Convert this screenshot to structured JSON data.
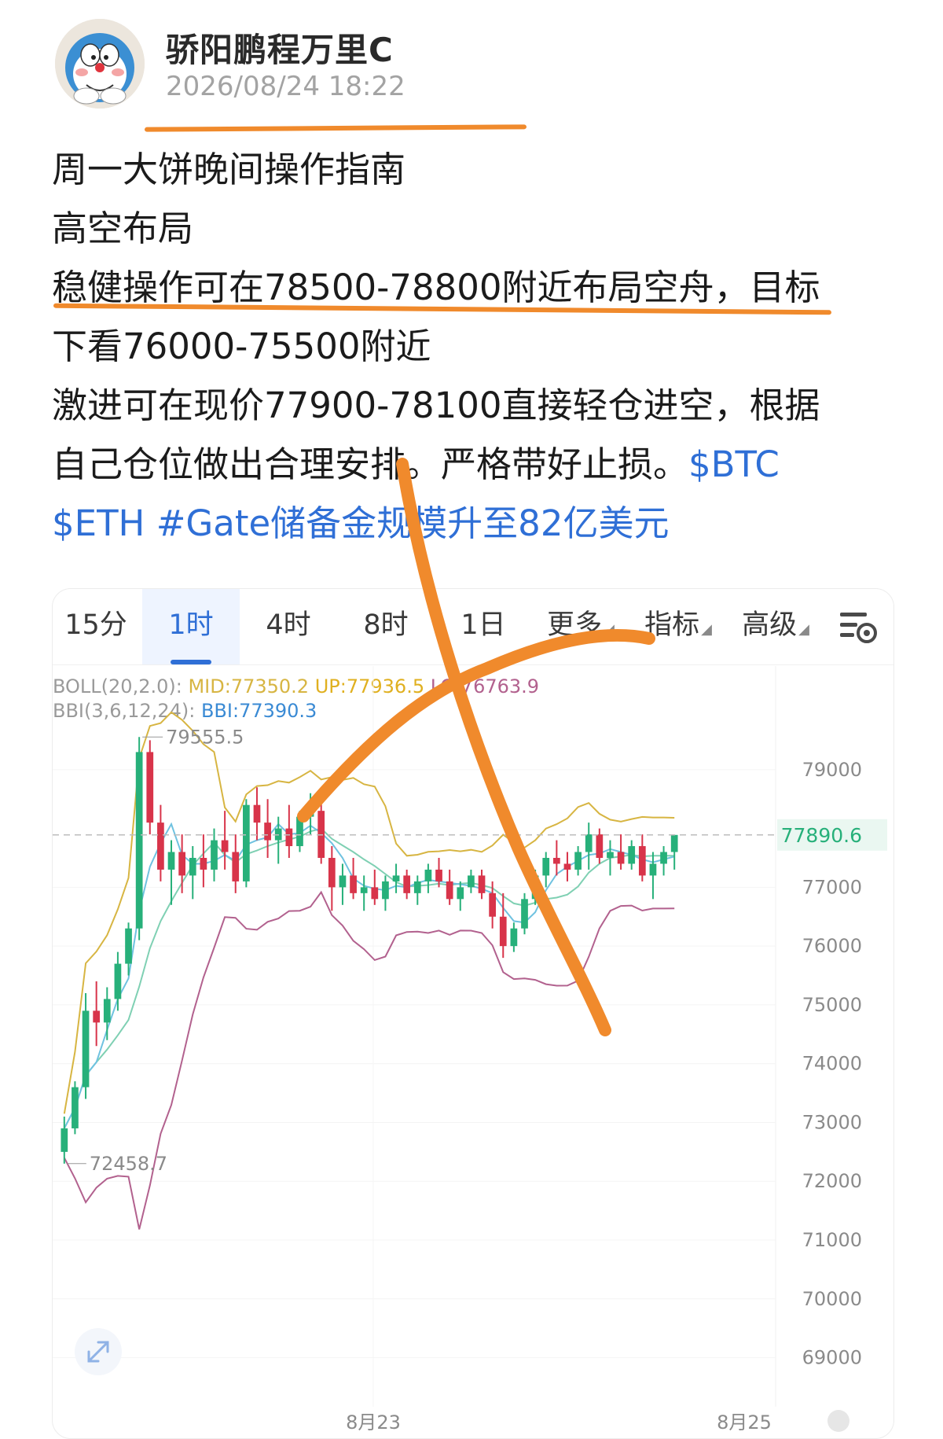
{
  "author": {
    "name": "骄阳鹏程万里C",
    "time": "2026/08/24 18:22"
  },
  "post": {
    "lines": [
      "周一大饼晚间操作指南",
      "高空布局",
      "稳健操作可在78500-78800附近布局空舟，目标",
      "下看76000-75500附近",
      "激进可在现价77900-78100直接轻仓进空，根据",
      "自己仓位做出合理安排。严格带好止损。"
    ],
    "tags": [
      "$BTC",
      "$ETH",
      "#Gate储备金规模升至82亿美元"
    ]
  },
  "chart": {
    "tabs": [
      {
        "label": "15分"
      },
      {
        "label": "1时",
        "active": true
      },
      {
        "label": "4时"
      },
      {
        "label": "8时"
      },
      {
        "label": "1日"
      },
      {
        "label": "更多",
        "caret": true
      },
      {
        "label": "指标",
        "caret": true
      },
      {
        "label": "高级",
        "caret": true
      }
    ],
    "indicators": {
      "boll_label": "BOLL(20,2.0):",
      "mid": "MID:77350.2",
      "up": "UP:77936.5",
      "lo": "LO:76763.9",
      "bbi_label": "BBI(3,6,12,24):",
      "bbi": "BBI:77390.3"
    },
    "high_marker": "79555.5",
    "low_marker": "72458.7",
    "current_price": "77890.6",
    "x_labels": [
      "8月23",
      "8月25"
    ],
    "colors": {
      "up": "#27b07a",
      "down": "#d8344a",
      "mid": "#d7b542",
      "lower": "#b2618e",
      "bbi": "#3a8ad4",
      "annotation": "#f08a2c",
      "price_tag": "#27b07a"
    }
  },
  "chart_data": {
    "type": "candlestick",
    "y_ticks": [
      79000,
      77000,
      76000,
      75000,
      74000,
      73000,
      72000,
      71000,
      70000,
      69000
    ],
    "ylim": [
      68700,
      79800
    ],
    "x_ticks": [
      "8月23",
      "8月25"
    ],
    "candles": [
      [
        72500,
        73100,
        72300,
        72900
      ],
      [
        72900,
        73700,
        72800,
        73600
      ],
      [
        73600,
        75200,
        73400,
        74900
      ],
      [
        74900,
        75400,
        74300,
        74700
      ],
      [
        74700,
        75300,
        74400,
        75100
      ],
      [
        75100,
        75900,
        74900,
        75700
      ],
      [
        75700,
        76400,
        75500,
        76300
      ],
      [
        76300,
        79555.5,
        76100,
        79300
      ],
      [
        79300,
        79500,
        77900,
        78100
      ],
      [
        78100,
        78400,
        77100,
        77300
      ],
      [
        77300,
        77800,
        76700,
        77600
      ],
      [
        77600,
        77900,
        76900,
        77200
      ],
      [
        77200,
        77700,
        76800,
        77500
      ],
      [
        77500,
        77900,
        77000,
        77300
      ],
      [
        77300,
        78000,
        77100,
        77800
      ],
      [
        77800,
        78300,
        77300,
        77600
      ],
      [
        77600,
        77900,
        76900,
        77100
      ],
      [
        77100,
        78500,
        77000,
        78400
      ],
      [
        78400,
        78700,
        77800,
        78100
      ],
      [
        78100,
        78500,
        77500,
        77800
      ],
      [
        77800,
        78200,
        77400,
        78000
      ],
      [
        78000,
        78400,
        77500,
        77700
      ],
      [
        77700,
        78300,
        77600,
        78200
      ],
      [
        78200,
        78600,
        77900,
        78300
      ],
      [
        78300,
        78500,
        77400,
        77500
      ],
      [
        77500,
        77700,
        76600,
        77000
      ],
      [
        77000,
        77400,
        76700,
        77200
      ],
      [
        77200,
        77500,
        76800,
        76900
      ],
      [
        76900,
        77200,
        76600,
        77000
      ],
      [
        77000,
        77300,
        76700,
        76800
      ],
      [
        76800,
        77200,
        76600,
        77100
      ],
      [
        77100,
        77400,
        76900,
        77200
      ],
      [
        77200,
        77300,
        76800,
        76900
      ],
      [
        76900,
        77200,
        76700,
        77100
      ],
      [
        77100,
        77400,
        76900,
        77300
      ],
      [
        77300,
        77500,
        77000,
        77100
      ],
      [
        77100,
        77300,
        76700,
        76800
      ],
      [
        76800,
        77100,
        76600,
        77000
      ],
      [
        77000,
        77300,
        76900,
        77200
      ],
      [
        77200,
        77300,
        76800,
        76900
      ],
      [
        76900,
        77100,
        76300,
        76500
      ],
      [
        76500,
        76900,
        75800,
        76000
      ],
      [
        76000,
        76400,
        75900,
        76300
      ],
      [
        76300,
        76900,
        76200,
        76800
      ],
      [
        76800,
        77300,
        76700,
        77200
      ],
      [
        77200,
        77600,
        77000,
        77500
      ],
      [
        77500,
        77800,
        77200,
        77400
      ],
      [
        77400,
        77600,
        77100,
        77300
      ],
      [
        77300,
        77700,
        77200,
        77600
      ],
      [
        77600,
        78100,
        77300,
        77900
      ],
      [
        77900,
        78000,
        77400,
        77500
      ],
      [
        77500,
        77800,
        77200,
        77600
      ],
      [
        77600,
        77900,
        77300,
        77400
      ],
      [
        77400,
        77800,
        77300,
        77700
      ],
      [
        77700,
        77900,
        77100,
        77200
      ],
      [
        77200,
        77600,
        76800,
        77400
      ],
      [
        77400,
        77700,
        77200,
        77600
      ],
      [
        77600,
        77890.6,
        77300,
        77890.6
      ]
    ]
  }
}
